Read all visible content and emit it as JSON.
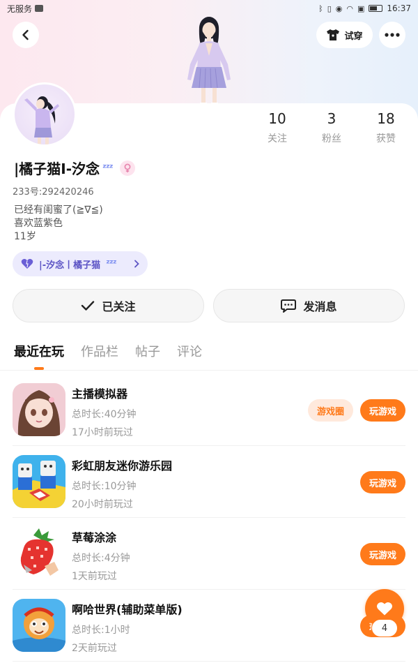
{
  "status_bar": {
    "carrier": "无服务",
    "time": "16:37"
  },
  "header": {
    "tryon_label": "试穿"
  },
  "stats": [
    {
      "value": "10",
      "label": "关注"
    },
    {
      "value": "3",
      "label": "粉丝"
    },
    {
      "value": "18",
      "label": "获赞"
    }
  ],
  "profile": {
    "username": "|橘子猫I-汐念",
    "uid": "233号:292420246",
    "bio": [
      "已经有闺蜜了(≧∇≦)",
      "喜欢蓝紫色",
      "11岁"
    ],
    "club_tag": "|-汐念丨橘子猫"
  },
  "actions": {
    "follow_label": "已关注",
    "message_label": "发消息"
  },
  "tabs": [
    "最近在玩",
    "作品栏",
    "帖子",
    "评论"
  ],
  "games": [
    {
      "name": "主播模拟器",
      "duration": "总时长:40分钟",
      "last_played": "17小时前玩过",
      "circle_label": "游戏圈",
      "play_label": "玩游戏"
    },
    {
      "name": "彩虹朋友迷你游乐园",
      "duration": "总时长:10分钟",
      "last_played": "20小时前玩过",
      "play_label": "玩游戏"
    },
    {
      "name": "草莓涂涂",
      "duration": "总时长:4分钟",
      "last_played": "1天前玩过",
      "play_label": "玩游戏"
    },
    {
      "name": "啊哈世界(辅助菜单版)",
      "duration": "总时长:1小时",
      "last_played": "2天前玩过",
      "play_label": "玩游戏"
    }
  ],
  "fab": {
    "count": "4"
  },
  "colors": {
    "accent": "#ff7a1a",
    "club_tag_bg": "#ecebfd",
    "club_tag_text": "#5c54c5"
  }
}
